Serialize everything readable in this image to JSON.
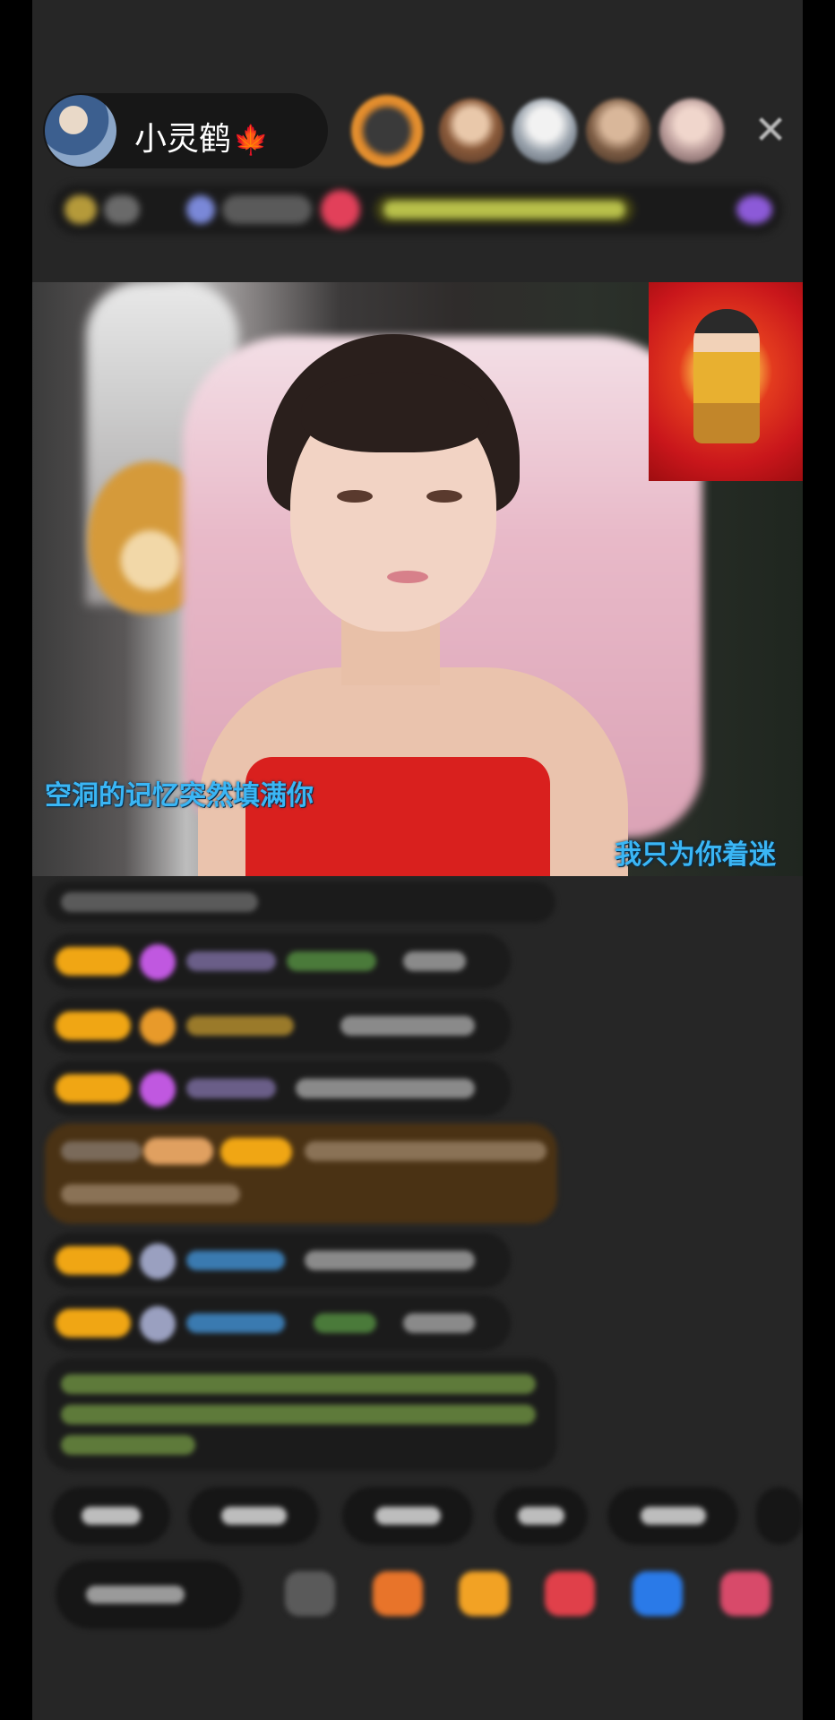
{
  "host": {
    "name": "小灵鹤",
    "badge_icon": "maple-leaf-icon"
  },
  "stream": {
    "lyric_left": "空洞的记忆突然填满你",
    "lyric_right": "我只为你着迷",
    "pip_icon": "fortune-god-image"
  },
  "viewers": [
    "viewer-avatar-1",
    "viewer-avatar-2",
    "viewer-avatar-3",
    "viewer-avatar-4",
    "viewer-avatar-5"
  ],
  "colors": {
    "background": "#262626",
    "lyric": "#3ab6f5",
    "badge": "#f0a614",
    "highlight_bubble": "#4a3214"
  }
}
